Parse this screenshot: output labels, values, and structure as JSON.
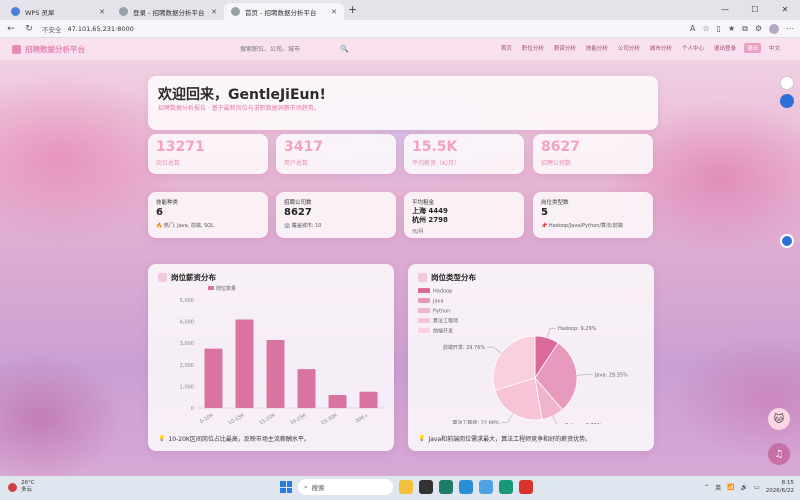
{
  "browser": {
    "tabs": [
      {
        "title": "WPS 灵犀",
        "color": "#4a7fe0"
      },
      {
        "title": "登录 - 招聘数据分析平台",
        "color": "#9aa0a8"
      },
      {
        "title": "首页 - 招聘数据分析平台",
        "color": "#9aa0a8"
      }
    ],
    "new_tab": "+",
    "url_warning": "不安全",
    "url": "47.101.65.231:8000"
  },
  "site": {
    "brand": "招聘数据分析平台",
    "search_placeholder": "搜索职位、公司、城市",
    "menu": [
      "首页",
      "职位分析",
      "薪资分析",
      "技能分析",
      "公司分析",
      "城市分析",
      "个人中心",
      "退出登录",
      "退出",
      "中文"
    ],
    "active_menu_index": 8
  },
  "welcome": {
    "title": "欢迎回来，GentleJiEun!",
    "subtitle": "招聘数据分析报告 · 基于最新岗位与求职数据洞察市场趋势。"
  },
  "stats": [
    {
      "value": "13271",
      "label": "岗位总数"
    },
    {
      "value": "3417",
      "label": "用户总数"
    },
    {
      "value": "15.5K",
      "label": "平均薪资（K/月）"
    },
    {
      "value": "8627",
      "label": "招聘公司数"
    }
  ],
  "mini_cards": [
    {
      "title": "技能种类",
      "value": "6",
      "sub": "🔥 热门: Java, 前端, SQL"
    },
    {
      "title": "招聘公司数",
      "value": "8627",
      "sub": "🏢 覆盖城市: 10"
    },
    {
      "title": "平均租金",
      "value_lines": [
        "上海 4449",
        "杭州 2798"
      ],
      "sub": "元/月"
    },
    {
      "title": "岗位类型数",
      "value": "5",
      "sub": "📌 Hadoop/Java/Python/算法/前端"
    }
  ],
  "salary_chart": {
    "title": "岗位薪资分布",
    "note": "10-20K区间岗位占比最高，反映市场主流薪酬水平。"
  },
  "type_chart": {
    "title": "岗位类型分布",
    "note": "Java和前端岗位需求最大，算法工程师竞争和好的薪资优势。"
  },
  "chart_data": [
    {
      "type": "bar",
      "title": "岗位薪资分布",
      "legend": [
        "岗位数量"
      ],
      "categories": [
        "0-10K",
        "10-15K",
        "15-20K",
        "20-25K",
        "25-30K",
        "30K+"
      ],
      "values": [
        2750,
        4100,
        3150,
        1800,
        600,
        750
      ],
      "ylim": [
        0,
        5000
      ],
      "yticks": [
        "0",
        "1,000",
        "2,000",
        "3,000",
        "4,000",
        "5,000"
      ],
      "color": "#d9739f"
    },
    {
      "type": "pie",
      "title": "岗位类型分布",
      "legend": [
        "Hadoop",
        "Java",
        "Python",
        "算法工程师",
        "前端开发"
      ],
      "slices": [
        {
          "name": "Hadoop",
          "label": "Hadoop: 9.29%",
          "value": 9.29,
          "color": "#d96a9a"
        },
        {
          "name": "Java",
          "label": "Java: 29.35%",
          "value": 29.35,
          "color": "#e79abb"
        },
        {
          "name": "Python",
          "label": "Python: 8.72%",
          "value": 8.72,
          "color": "#f0b5cc"
        },
        {
          "name": "算法工程师",
          "label": "算法工程师: 22.88%",
          "value": 22.88,
          "color": "#f6c4d6"
        },
        {
          "name": "前端开发",
          "label": "前端开发: 29.76%",
          "value": 29.76,
          "color": "#f9d0de"
        }
      ]
    }
  ],
  "taskbar": {
    "weather_temp": "26°C",
    "weather_text": "多云",
    "search_label": "搜索",
    "ime": "英",
    "time": "8:15",
    "date": "2026/6/22"
  }
}
